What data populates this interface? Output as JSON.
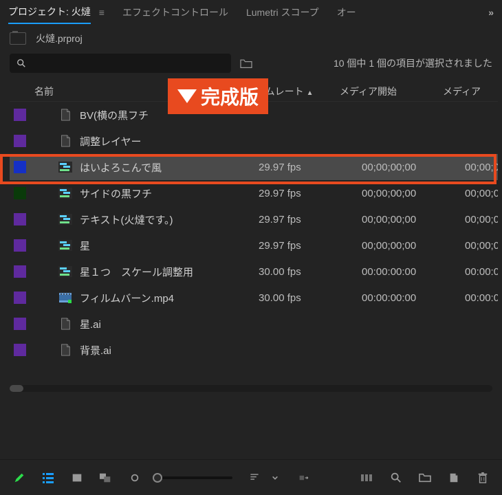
{
  "tabs": {
    "project": "プロジェクト: 火燵",
    "effect": "エフェクトコントロール",
    "lumetri": "Lumetri スコープ",
    "overflow": "オー"
  },
  "project_file": "火燵.prproj",
  "search": {
    "placeholder": ""
  },
  "selection_status": "10 個中 1 個の項目が選択されました",
  "columns": {
    "name": "名前",
    "framerate": "フレームレート",
    "media_start": "メディア開始",
    "media_end": "メディア"
  },
  "callout": {
    "label": "完成版"
  },
  "rows": [
    {
      "swatch": "#5f2a9e",
      "icon": "file",
      "name": "BV(横の黒フチ",
      "fps": "",
      "start": "",
      "end": ""
    },
    {
      "swatch": "#5f2a9e",
      "icon": "file",
      "name": "調整レイヤー",
      "fps": "",
      "start": "",
      "end": ""
    },
    {
      "swatch": "#1530c5",
      "icon": "seq",
      "name": "はいよろこんで風",
      "fps": "29.97 fps",
      "start": "00;00;00;00",
      "end": "00;00;0",
      "selected": true
    },
    {
      "swatch": "#0a3a0a",
      "icon": "seq",
      "name": "サイドの黒フチ",
      "fps": "29.97 fps",
      "start": "00;00;00;00",
      "end": "00;00;0"
    },
    {
      "swatch": "#5f2a9e",
      "icon": "seq",
      "name": "テキスト(火燵です。)",
      "fps": "29.97 fps",
      "start": "00;00;00;00",
      "end": "00;00;0"
    },
    {
      "swatch": "#5f2a9e",
      "icon": "seq",
      "name": "星",
      "fps": "29.97 fps",
      "start": "00;00;00;00",
      "end": "00;00;0"
    },
    {
      "swatch": "#5f2a9e",
      "icon": "seq",
      "name": "星１つ　スケール調整用",
      "fps": "30.00 fps",
      "start": "00:00:00:00",
      "end": "00:00:0"
    },
    {
      "swatch": "#5f2a9e",
      "icon": "video",
      "name": "フィルムバーン.mp4",
      "fps": "30.00 fps",
      "start": "00:00:00:00",
      "end": "00:00:0"
    },
    {
      "swatch": "#5f2a9e",
      "icon": "file",
      "name": "星.ai",
      "fps": "",
      "start": "",
      "end": ""
    },
    {
      "swatch": "#5f2a9e",
      "icon": "file",
      "name": "背景.ai",
      "fps": "",
      "start": "",
      "end": ""
    }
  ]
}
